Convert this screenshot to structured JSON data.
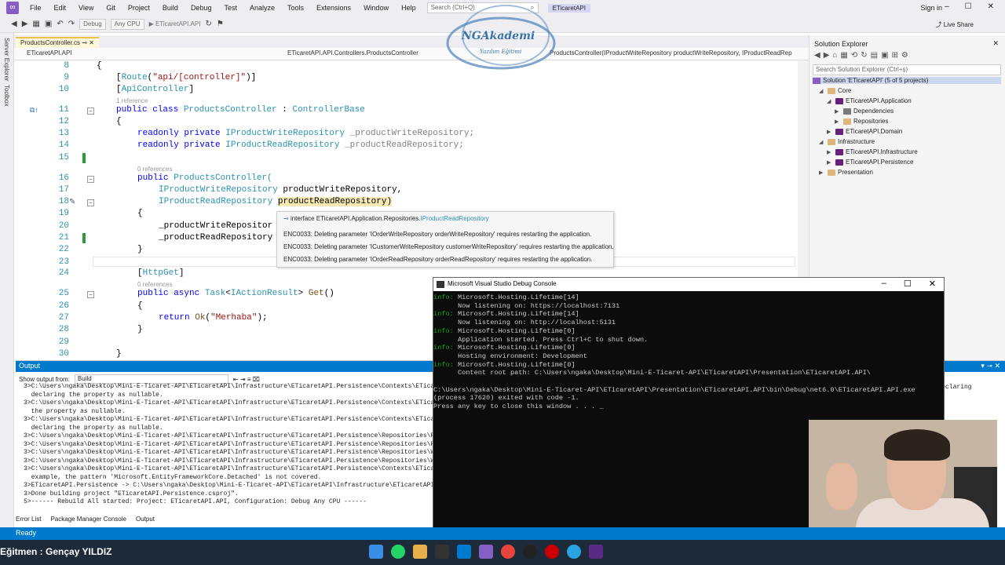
{
  "menubar": {
    "items": [
      "File",
      "Edit",
      "View",
      "Git",
      "Project",
      "Build",
      "Debug",
      "Test",
      "Analyze",
      "Tools",
      "Extensions",
      "Window",
      "Help"
    ],
    "search_placeholder": "Search (Ctrl+Q)",
    "project_badge": "ETicaretAPI",
    "signin": "Sign in"
  },
  "toolbar": {
    "config": "Debug",
    "platform": "Any CPU",
    "run_target": "ETicaretAPI.API",
    "live_share": "Live Share"
  },
  "leftbar": {
    "server_explorer": "Server Explorer",
    "toolbox": "Toolbox"
  },
  "doc_tab": "ProductsController.cs",
  "navbar": {
    "project": "ETicaretAPI.API",
    "class": "ETicaretAPI.API.Controllers.ProductsController",
    "member": "ProductsController(IProductWriteRepository productWriteRepository, IProductReadRep"
  },
  "code": {
    "ln8": "8",
    "ln9": "9",
    "ln10": "10",
    "ln11": "11",
    "ln12": "12",
    "ln13": "13",
    "ln14": "14",
    "ln15": "15",
    "ln16": "16",
    "ln17": "17",
    "ln18": "18",
    "ln19": "19",
    "ln20": "20",
    "ln21": "21",
    "ln22": "22",
    "ln23": "23",
    "ln24": "24",
    "ln25": "25",
    "ln26": "26",
    "ln27": "27",
    "ln28": "28",
    "ln29": "29",
    "ln30": "30",
    "ref1": "1 reference",
    "ref0a": "0 references",
    "ref0b": "0 references",
    "route_attr": "Route",
    "route_val": "\"api/[controller]\"",
    "apicontroller": "ApiController",
    "class_kw": "public class ",
    "class_name": "ProductsController",
    "base_class": "ControllerBase",
    "readonly_private": "readonly private ",
    "write_iface": "IProductWriteRepository",
    "write_field": "_productWriteRepository;",
    "read_iface": "IProductReadRepository",
    "read_field": "_productReadRepository;",
    "public_kw": "public ",
    "ctor_name": "ProductsController(",
    "param1_type": "IProductWriteRepository",
    "param1_name": " productWriteRepository,",
    "param2_type": "IProductReadRepository",
    "param2_name": "productReadRepository)",
    "assign1": "_productWriteRepositor",
    "assign2": "_productReadRepository",
    "httpget": "HttpGet",
    "public_async": "public async ",
    "task": "Task",
    "iaction": "IActionResult",
    "get_fn": "Get",
    "return_kw": "return ",
    "ok_fn": "Ok",
    "merhaba": "\"Merhaba\""
  },
  "tooltip": {
    "line1_prefix": "interface ETicaretAPI.Application.Repositories.",
    "line1_type": "IProductReadRepository",
    "line2": "ENC0033: Deleting parameter 'IOrderWriteRepository orderWriteRepository' requires restarting the application.",
    "line3": "ENC0033: Deleting parameter 'ICustomerWriteRepository customerWriteRepository' requires restarting the application.",
    "line4": "ENC0033: Deleting parameter 'IOrderReadRepository orderReadRepository' requires restarting the application."
  },
  "solution": {
    "title": "Solution Explorer",
    "search_placeholder": "Search Solution Explorer (Ctrl+ş)",
    "items": [
      "Solution 'ETicaretAPI' (5 of 5 projects)",
      "Core",
      "ETicaretAPI.Application",
      "Dependencies",
      "Repositories",
      "ETicaretAPI.Domain",
      "Infrastructure",
      "ETicaretAPI.Infrastructure",
      "ETicaretAPI.Persistence",
      "Presentation"
    ]
  },
  "output": {
    "title": "Output",
    "show_from": "Show output from:",
    "source": "Build",
    "lines": [
      "3>C:\\Users\\ngaka\\Desktop\\Mini-E-Ticaret-API\\ETicaretAPI\\Infrastructure\\ETicaretAPI.Persistence\\Contexts\\ETicar",
      "  declaring the property as nullable.",
      "3>C:\\Users\\ngaka\\Desktop\\Mini-E-Ticaret-API\\ETicaretAPI\\Infrastructure\\ETicaretAPI.Persistence\\Contexts\\ETicar",
      "  the property as nullable.",
      "3>C:\\Users\\ngaka\\Desktop\\Mini-E-Ticaret-API\\ETicaretAPI\\Infrastructure\\ETicaretAPI.Persistence\\Contexts\\ETicar",
      "  declaring the property as nullable.",
      "3>C:\\Users\\ngaka\\Desktop\\Mini-E-Ticaret-API\\ETicaretAPI\\Infrastructure\\ETicaretAPI.Persistence\\Repositories\\Read",
      "3>C:\\Users\\ngaka\\Desktop\\Mini-E-Ticaret-API\\ETicaretAPI\\Infrastructure\\ETicaretAPI.Persistence\\Repositories\\Read",
      "3>C:\\Users\\ngaka\\Desktop\\Mini-E-Ticaret-API\\ETicaretAPI\\Infrastructure\\ETicaretAPI.Persistence\\Repositories\\Writ",
      "3>C:\\Users\\ngaka\\Desktop\\Mini-E-Ticaret-API\\ETicaretAPI\\Infrastructure\\ETicaretAPI.Persistence\\Repositories\\Writ",
      "3>C:\\Users\\ngaka\\Desktop\\Mini-E-Ticaret-API\\ETicaretAPI\\Infrastructure\\ETicaretAPI.Persistence\\Contexts\\ETicar",
      "  example, the pattern 'Microsoft.EntityFrameworkCore.Detached' is not covered.",
      "3>ETicaretAPI.Persistence -> C:\\Users\\ngaka\\Desktop\\Mini-E-Ticaret-API\\ETicaretAPI\\Infrastructure\\ETicaretAPI.Pe",
      "3>Done building project \"ETicaretAPI.Persistence.csproj\".",
      "5>------ Rebuild All started: Project: ETicaretAPI.API, Configuration: Debug Any CPU ------"
    ],
    "right1": "er declaring",
    "right2": "sider",
    "tabs": [
      "Error List",
      "Package Manager Console",
      "Output"
    ]
  },
  "console": {
    "title": "Microsoft Visual Studio Debug Console",
    "lines": [
      {
        "tag": "info:",
        "text": " Microsoft.Hosting.Lifetime[14]"
      },
      {
        "tag": "",
        "text": "      Now listening on: https://localhost:7131"
      },
      {
        "tag": "info:",
        "text": " Microsoft.Hosting.Lifetime[14]"
      },
      {
        "tag": "",
        "text": "      Now listening on: http://localhost:5131"
      },
      {
        "tag": "info:",
        "text": " Microsoft.Hosting.Lifetime[0]"
      },
      {
        "tag": "",
        "text": "      Application started. Press Ctrl+C to shut down."
      },
      {
        "tag": "info:",
        "text": " Microsoft.Hosting.Lifetime[0]"
      },
      {
        "tag": "",
        "text": "      Hosting environment: Development"
      },
      {
        "tag": "info:",
        "text": " Microsoft.Hosting.Lifetime[0]"
      },
      {
        "tag": "",
        "text": "      Content root path: C:\\Users\\ngaka\\Desktop\\Mini-E-Ticaret-API\\ETicaretAPI\\Presentation\\ETicaretAPI.API\\"
      },
      {
        "tag": "",
        "text": ""
      },
      {
        "tag": "",
        "text": "C:\\Users\\ngaka\\Desktop\\Mini-E-Ticaret-API\\ETicaretAPI\\Presentation\\ETicaretAPI.API\\bin\\Debug\\net6.0\\ETicaretAPI.API.exe"
      },
      {
        "tag": "",
        "text": "(process 17620) exited with code -1."
      },
      {
        "tag": "",
        "text": "Press any key to close this window . . ."
      }
    ]
  },
  "status": "Ready",
  "instructor": "Eğitmen : Gençay YILDIZ",
  "watermark": {
    "brand": "NGAkademi",
    "sub": "Yazılım Eğitimi"
  },
  "colors": {
    "accent": "#007acc",
    "vs_purple": "#865fc5",
    "console_info": "#13a10e"
  }
}
